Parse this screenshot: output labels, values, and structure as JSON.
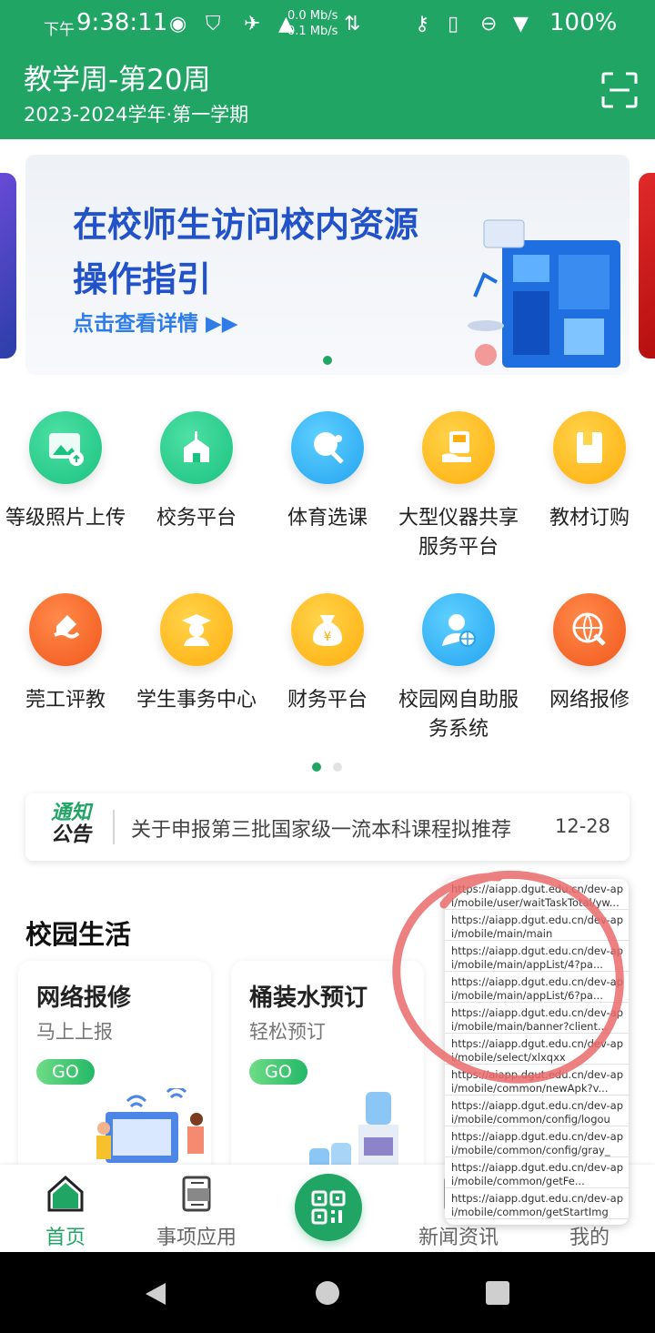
{
  "status": {
    "ampm": "下午",
    "time": "9:38:11",
    "speed_up": "0.0 Mb/s",
    "speed_down": "0.1 Mb/s",
    "battery": "100%"
  },
  "header": {
    "week": "教学周-第20周",
    "term": "2023-2024学年·第一学期"
  },
  "banner": {
    "title_line1": "在校师生访问校内资源",
    "title_line2": "操作指引",
    "link": "点击查看详情 ▶▶"
  },
  "apps": [
    {
      "label": "等级照片上传",
      "icon": "photo-upload-icon"
    },
    {
      "label": "校务平台",
      "icon": "school-icon"
    },
    {
      "label": "体育选课",
      "icon": "table-tennis-icon"
    },
    {
      "label": "大型仪器共享服务平台",
      "icon": "instrument-icon"
    },
    {
      "label": "教材订购",
      "icon": "book-icon"
    },
    {
      "label": "莞工评教",
      "icon": "evaluation-icon"
    },
    {
      "label": "学生事务中心",
      "icon": "student-icon"
    },
    {
      "label": "财务平台",
      "icon": "money-bag-icon"
    },
    {
      "label": "校园网自助服务系统",
      "icon": "network-user-icon"
    },
    {
      "label": "网络报修",
      "icon": "globe-repair-icon"
    }
  ],
  "notice": {
    "logo_line1": "通知",
    "logo_line2": "公告",
    "text": "关于申报第三批国家级一流本科课程拟推荐",
    "date": "12-28"
  },
  "campus": {
    "title": "校园生活",
    "cards": [
      {
        "title": "网络报修",
        "subtitle": "马上上报",
        "go": "GO"
      },
      {
        "title": "桶装水预订",
        "subtitle": "轻松预订",
        "go": "GO"
      }
    ]
  },
  "nav": {
    "home": "首页",
    "apps": "事项应用",
    "news": "新闻资讯",
    "mine": "我的"
  },
  "debug_urls": [
    "https://aiapp.dgut.edu.cn/dev-api/mobile/user/waitTaskTotal/yw...",
    "https://aiapp.dgut.edu.cn/dev-api/mobile/main/main",
    "https://aiapp.dgut.edu.cn/dev-api/mobile/main/appList/4?pa...",
    "https://aiapp.dgut.edu.cn/dev-api/mobile/main/appList/6?pa...",
    "https://aiapp.dgut.edu.cn/dev-api/mobile/main/banner?client...",
    "https://aiapp.dgut.edu.cn/dev-api/mobile/select/xlxqxx",
    "https://aiapp.dgut.edu.cn/dev-api/mobile/common/newApk?v...",
    "https://aiapp.dgut.edu.cn/dev-api/mobile/common/config/logout...",
    "https://aiapp.dgut.edu.cn/dev-api/mobile/common/config/gray_a...",
    "https://aiapp.dgut.edu.cn/dev-api/mobile/common/getFe...",
    "https://aiapp.dgut.edu.cn/dev-api/mobile/common/getStartImg"
  ],
  "colors": {
    "brand": "#21a565",
    "annotation": "#ea6a6a"
  }
}
